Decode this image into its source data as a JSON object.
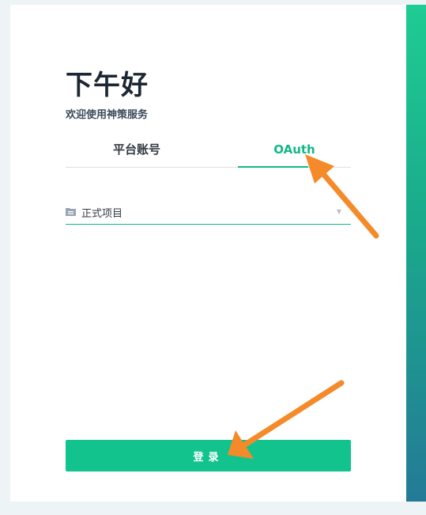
{
  "page": {
    "greeting": "下午好",
    "subtitle": "欢迎使用神策服务"
  },
  "tabs": [
    {
      "label": "平台账号",
      "active": false
    },
    {
      "label": "OAuth",
      "active": true
    }
  ],
  "project_select": {
    "icon": "folder-icon",
    "value": "正式项目"
  },
  "login_button": {
    "label": "登录"
  },
  "colors": {
    "accent": "#12b886",
    "button": "#12c38d",
    "annotation": "#f58a2a"
  }
}
